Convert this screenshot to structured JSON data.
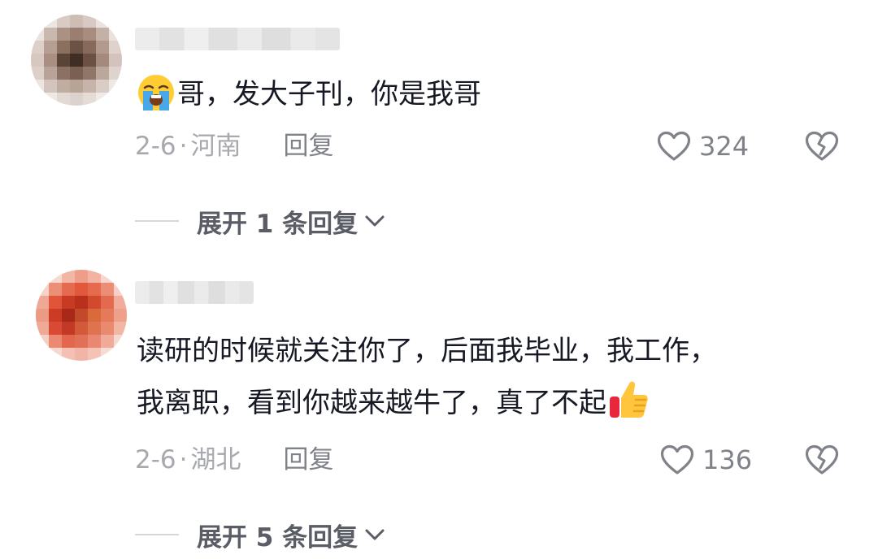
{
  "comments": [
    {
      "text": "哥，发大子刊，你是我哥",
      "emoji": "loudly-crying-face",
      "date": "2-6",
      "separator": "·",
      "location": "河南",
      "reply_label": "回复",
      "likes": "324",
      "expand_label": "展开 1 条回复"
    },
    {
      "text_line1": "读研的时候就关注你了，后面我毕业，我工作，",
      "text_line2": "我离职，看到你越来越牛了，真了不起",
      "emoji": "thumbs-up",
      "date": "2-6",
      "separator": "·",
      "location": "湖北",
      "reply_label": "回复",
      "likes": "136",
      "expand_label": "展开 5 条回复"
    }
  ],
  "colors": {
    "text": "#161823",
    "meta": "#a7a9ae",
    "action": "#80828a",
    "expand": "#5b5d66",
    "emoji_yellow": "#ffcc33",
    "emoji_blue": "#4aa8e8",
    "thumb_red": "#e8273c"
  }
}
